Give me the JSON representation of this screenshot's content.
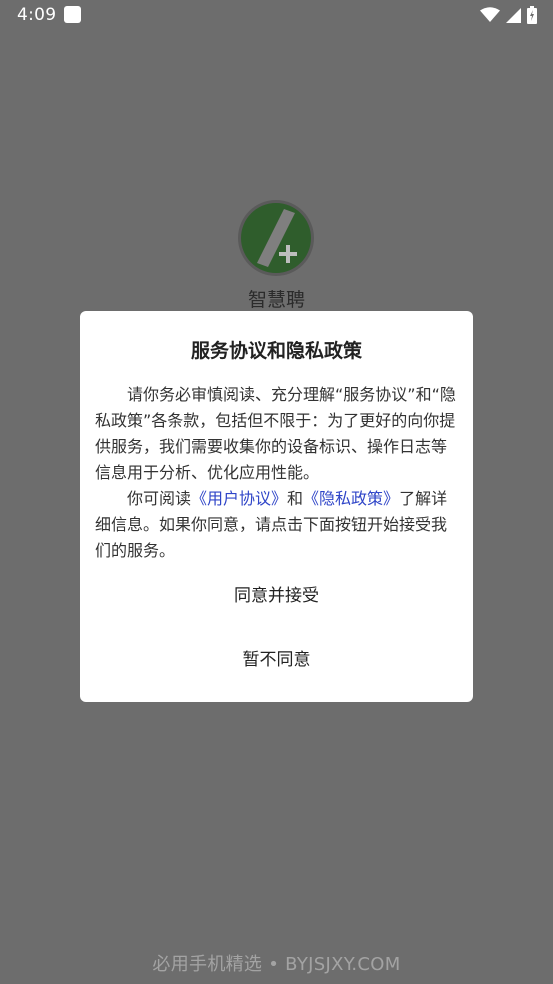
{
  "status_bar": {
    "time": "4:09"
  },
  "app": {
    "name": "智慧聘"
  },
  "dialog": {
    "title": "服务协议和隐私政策",
    "para1": "请你务必审慎阅读、充分理解“服务协议”和“隐私政策”各条款，包括但不限于：为了更好的向你提供服务，我们需要收集你的设备标识、操作日志等信息用于分析、优化应用性能。",
    "para2_prefix": "你可阅读",
    "link_user_agreement": "《用户协议》",
    "para2_and": "和",
    "link_privacy_policy": "《隐私政策》",
    "para2_suffix": "了解详细信息。如果你同意，请点击下面按钮开始接受我们的服务。",
    "agree_button": "同意并接受",
    "decline_button": "暂不同意"
  },
  "footer": {
    "watermark": "必用手机精选 • BYJSJXY.COM"
  },
  "colors": {
    "overlay": "#6d6d6d",
    "link": "#2f45c8",
    "logo_green": "#2f5d2c"
  }
}
